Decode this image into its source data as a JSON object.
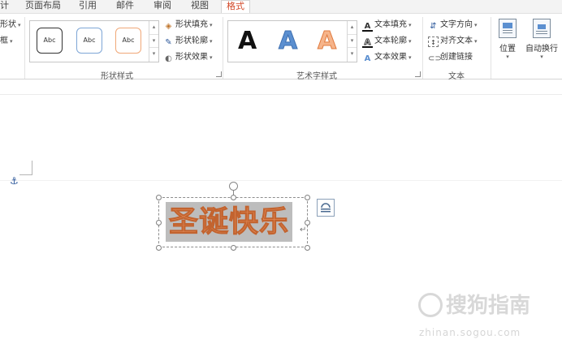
{
  "tabs": [
    {
      "label": "计",
      "active": false
    },
    {
      "label": "页面布局",
      "active": false
    },
    {
      "label": "引用",
      "active": false
    },
    {
      "label": "邮件",
      "active": false
    },
    {
      "label": "审阅",
      "active": false
    },
    {
      "label": "视图",
      "active": false
    },
    {
      "label": "格式",
      "active": true
    }
  ],
  "ribbon": {
    "left_partial": {
      "item1": "形状",
      "item2": "框"
    },
    "shape_styles": {
      "label": "形状样式",
      "presets": [
        "Abc",
        "Abc",
        "Abc"
      ],
      "fill": "形状填充",
      "outline": "形状轮廓",
      "effects": "形状效果"
    },
    "wordart_styles": {
      "label": "艺术字样式",
      "presets": [
        "A",
        "A",
        "A"
      ],
      "fill": "文本填充",
      "outline": "文本轮廓",
      "effects": "文本效果"
    },
    "text": {
      "label": "文本",
      "direction": "文字方向",
      "align": "对齐文本",
      "link": "创建链接"
    },
    "arrange": {
      "position": "位置",
      "wrap": "自动换行"
    }
  },
  "document": {
    "textbox_text": "圣诞快乐",
    "watermark_text": "搜狗指南",
    "watermark_url": "zhinan.sogou.com"
  },
  "colors": {
    "accent": "#d24726",
    "wordart_fill": "#e8905c",
    "wordart_outline": "#c2632f",
    "selection": "#bdbdbd"
  },
  "icons": {
    "anchor": "anchor-icon",
    "layout_options": "layout-options-icon",
    "rotate": "rotate-handle-icon"
  }
}
